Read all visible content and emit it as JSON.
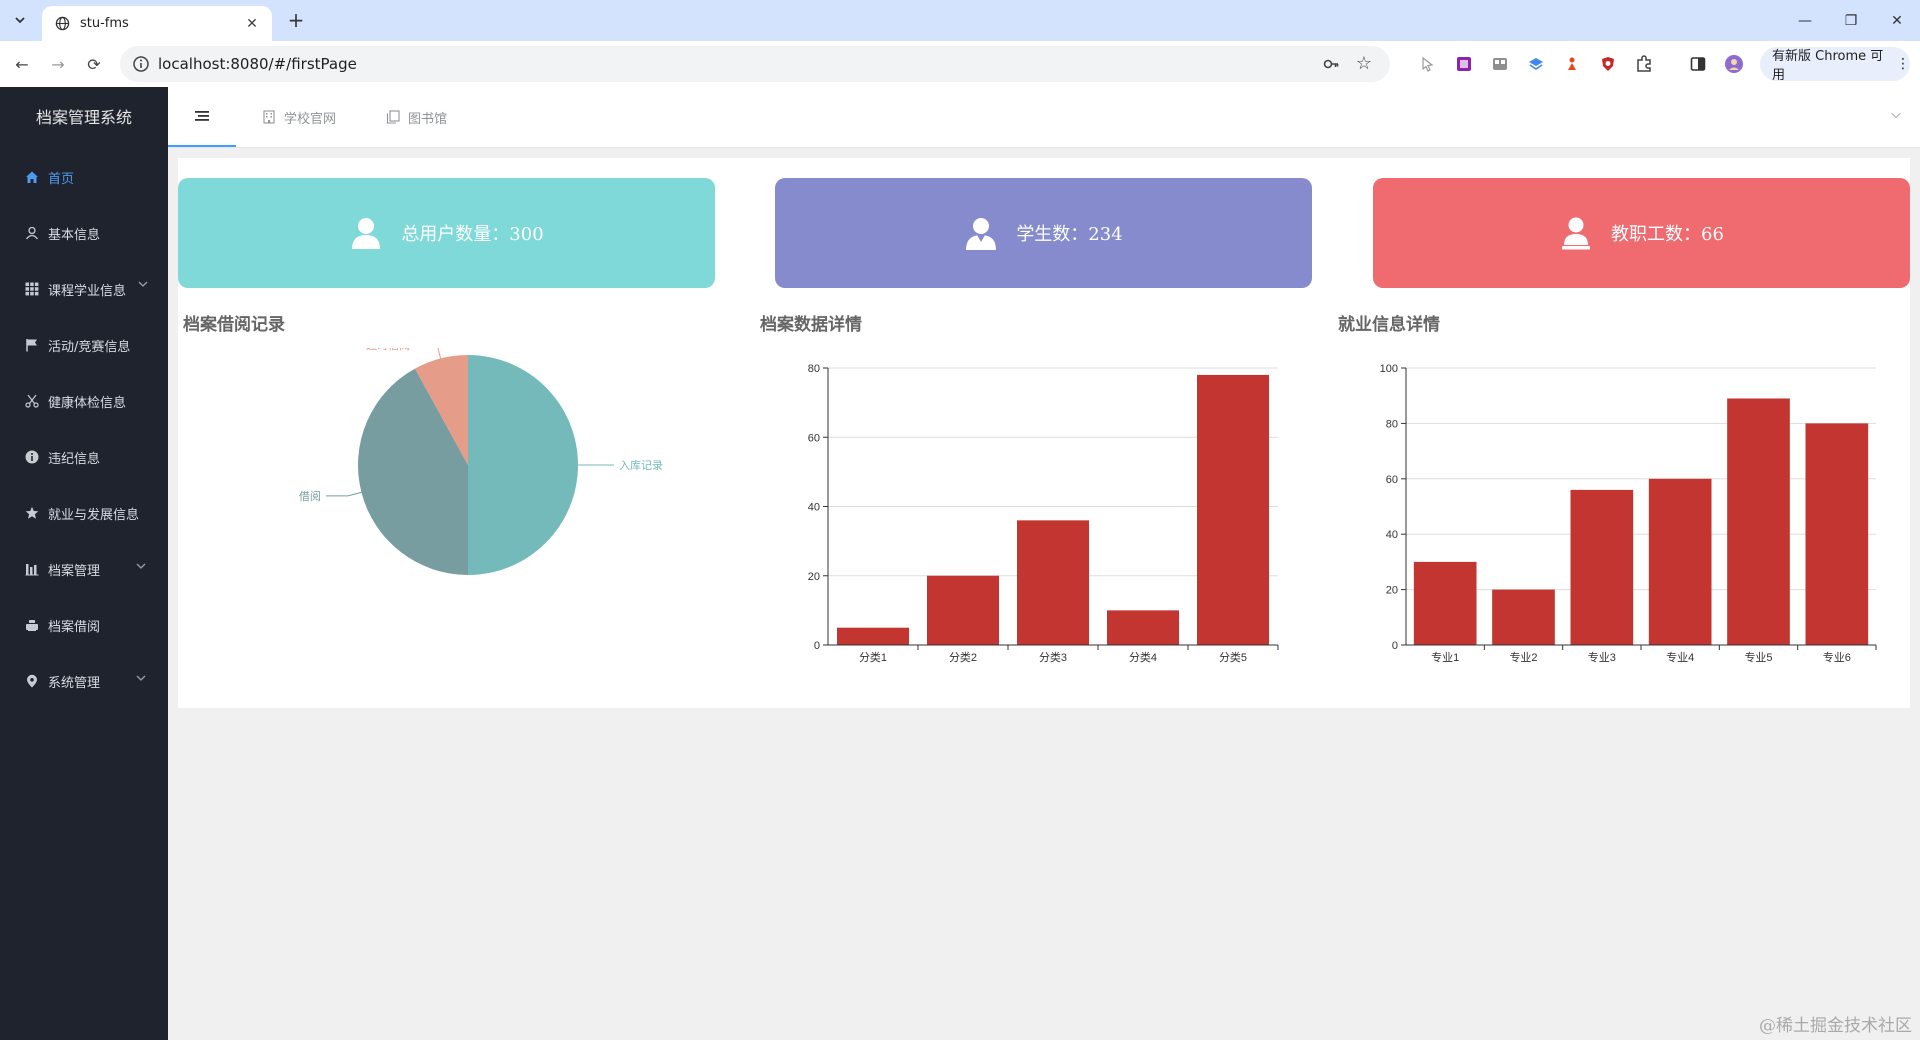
{
  "browser": {
    "tab_title": "stu-fms",
    "url": "localhost:8080/#/firstPage",
    "update_label": "有新版 Chrome 可用"
  },
  "sidebar": {
    "title": "档案管理系统",
    "items": [
      {
        "label": "首页",
        "icon": "home-icon",
        "active": true
      },
      {
        "label": "基本信息",
        "icon": "user-icon"
      },
      {
        "label": "课程学业信息",
        "icon": "grid-icon",
        "expandable": true
      },
      {
        "label": "活动/竞赛信息",
        "icon": "flag-icon"
      },
      {
        "label": "健康体检信息",
        "icon": "scissors-icon"
      },
      {
        "label": "违纪信息",
        "icon": "info-icon"
      },
      {
        "label": "就业与发展信息",
        "icon": "star-icon"
      },
      {
        "label": "档案管理",
        "icon": "bar-icon",
        "expandable": true
      },
      {
        "label": "档案借阅",
        "icon": "print-icon"
      },
      {
        "label": "系统管理",
        "icon": "location-icon",
        "expandable": true
      }
    ]
  },
  "topnav": {
    "links": [
      "学校官网",
      "图书馆"
    ]
  },
  "stats": [
    {
      "label": "总用户数量：300",
      "color": "#80d9d9"
    },
    {
      "label": "学生数：234",
      "color": "#868bcd"
    },
    {
      "label": "教职工数：66",
      "color": "#f06b70"
    }
  ],
  "charts": {
    "pie_title": "档案借阅记录",
    "bar1_title": "档案数据详情",
    "bar2_title": "就业信息详情"
  },
  "chart_data": [
    {
      "type": "pie",
      "title": "档案借阅记录",
      "slices": [
        {
          "name": "入库记录",
          "value": 50,
          "color": "#74babb"
        },
        {
          "name": "借阅",
          "value": 42,
          "color": "#779da1"
        },
        {
          "name": "超时借阅",
          "value": 8,
          "color": "#e59d89"
        }
      ]
    },
    {
      "type": "bar",
      "title": "档案数据详情",
      "categories": [
        "分类1",
        "分类2",
        "分类3",
        "分类4",
        "分类5"
      ],
      "values": [
        5,
        20,
        36,
        10,
        78
      ],
      "ylim": [
        0,
        80
      ],
      "yticks": [
        "0",
        "20",
        "40",
        "60",
        "80"
      ],
      "color": "#c23531",
      "grid": true
    },
    {
      "type": "bar",
      "title": "就业信息详情",
      "categories": [
        "专业1",
        "专业2",
        "专业3",
        "专业4",
        "专业5",
        "专业6"
      ],
      "values": [
        30,
        20,
        56,
        60,
        89,
        80
      ],
      "ylim": [
        0,
        100
      ],
      "yticks": [
        "0",
        "20",
        "40",
        "60",
        "80",
        "100"
      ],
      "color": "#c23531",
      "grid": true
    }
  ],
  "watermark": "@稀土掘金技术社区"
}
